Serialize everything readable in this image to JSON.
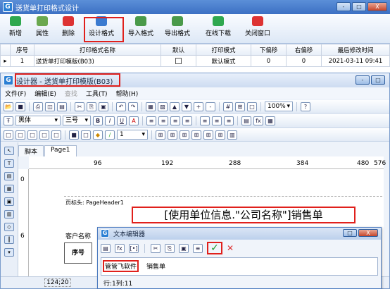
{
  "main_window": {
    "title": "送货单打印格式设计",
    "controls": {
      "min": "-",
      "max": "□",
      "close": "X"
    },
    "toolbar": [
      {
        "label": "新增",
        "icon": "plus-circle-icon",
        "color": "#2fa84f"
      },
      {
        "label": "属性",
        "icon": "edit-pencil-icon",
        "color": "#6aa84f"
      },
      {
        "label": "删除",
        "icon": "delete-x-icon",
        "color": "#d33"
      },
      {
        "label": "设计格式",
        "icon": "design-brush-icon",
        "color": "#3b7bd0"
      },
      {
        "label": "导入格式",
        "icon": "import-doc-icon",
        "color": "#4a9a4a"
      },
      {
        "label": "导出格式",
        "icon": "export-doc-icon",
        "color": "#4a9a4a"
      },
      {
        "label": "在线下载",
        "icon": "download-icon",
        "color": "#2fa84f"
      },
      {
        "label": "关闭窗口",
        "icon": "close-window-icon",
        "color": "#d33"
      }
    ],
    "table": {
      "headers": [
        "序号",
        "打印格式名称",
        "默认",
        "打印模式",
        "下偏移",
        "右偏移",
        "最后修改时间"
      ],
      "rows": [
        {
          "marker": "▸",
          "index": "1",
          "name": "送货单打印模版(B03)",
          "default": "",
          "mode": "默认模式",
          "down": "0",
          "right": "0",
          "modified": "2021-03-11 09:41"
        }
      ]
    }
  },
  "designer": {
    "title": "设计器 - 送货单打印模版(B03)",
    "controls": {
      "min": "-",
      "max": "□"
    },
    "menu": [
      "文件(F)",
      "编辑(E)",
      "查找",
      "工具(T)",
      "帮助(H)"
    ],
    "font_name": "黑体",
    "font_size": "三号",
    "zoom": "100%",
    "line_width": "1",
    "tabs": [
      "脚本",
      "Page1"
    ],
    "ruler_marks": [
      "96",
      "192",
      "288",
      "384",
      "480",
      "576"
    ],
    "vruler_marks": [
      "0",
      "6"
    ],
    "band_label": "页标头: PageHeader1",
    "header_text": "[使用单位信息.\"公司名称\"]销售单",
    "customer_label": "客户名称",
    "col_label": "序号",
    "status_pos": "124;20"
  },
  "text_editor": {
    "title": "文本编辑器",
    "content_highlight": "管管飞软件",
    "content_rest": "销售单",
    "status": "行:1列:11",
    "confirm": "✓",
    "cancel": "✕"
  }
}
